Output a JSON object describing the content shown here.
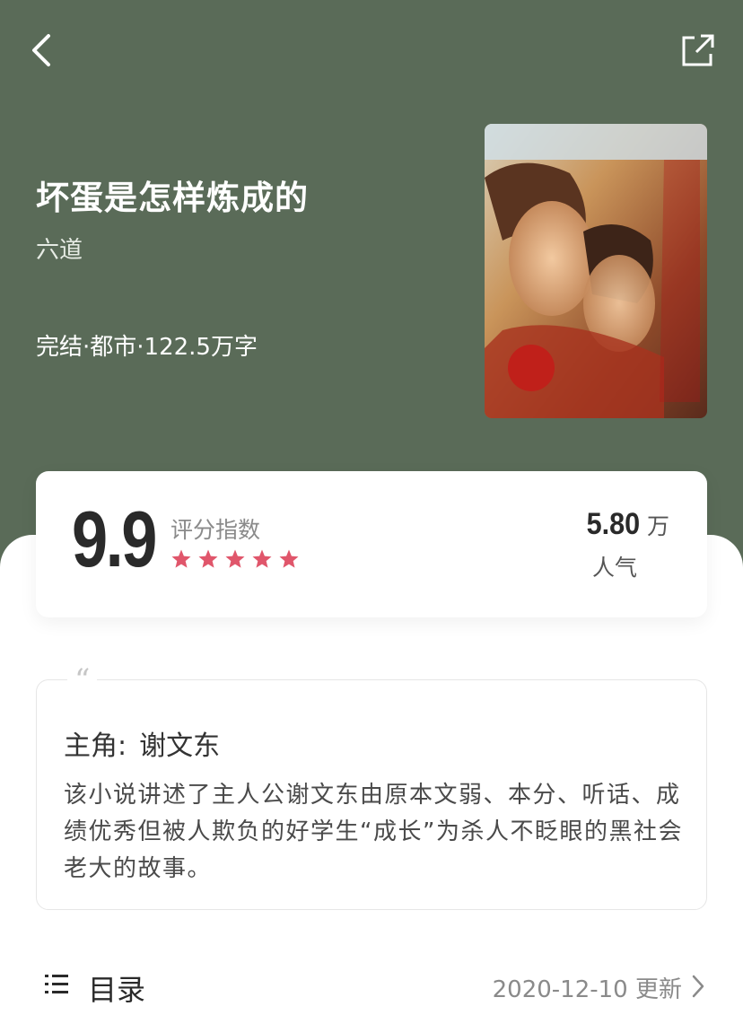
{
  "nav": {
    "back_icon": "chevron-left-icon",
    "share_icon": "share-external-icon"
  },
  "book": {
    "title": "坏蛋是怎样炼成的",
    "author": "六道",
    "meta": "完结·都市·122.5万字"
  },
  "rating": {
    "score": "9.9",
    "score_label": "评分指数",
    "stars": 5,
    "star_color": "#e0566b",
    "popularity_value": "5.80",
    "popularity_unit": "万",
    "popularity_label": "人气"
  },
  "intro": {
    "quote_mark": "“",
    "protagonist_label": "主角:",
    "protagonist_name": "谢文东",
    "synopsis": "该小说讲述了主人公谢文东由原本文弱、本分、听话、成绩优秀但被人欺负的好学生“成长”为杀人不眨眼的黑社会老大的故事。"
  },
  "toc": {
    "icon": "list-icon",
    "label": "目录",
    "updated": "2020-12-10 更新"
  },
  "colors": {
    "header_bg": "#5a6b58"
  }
}
